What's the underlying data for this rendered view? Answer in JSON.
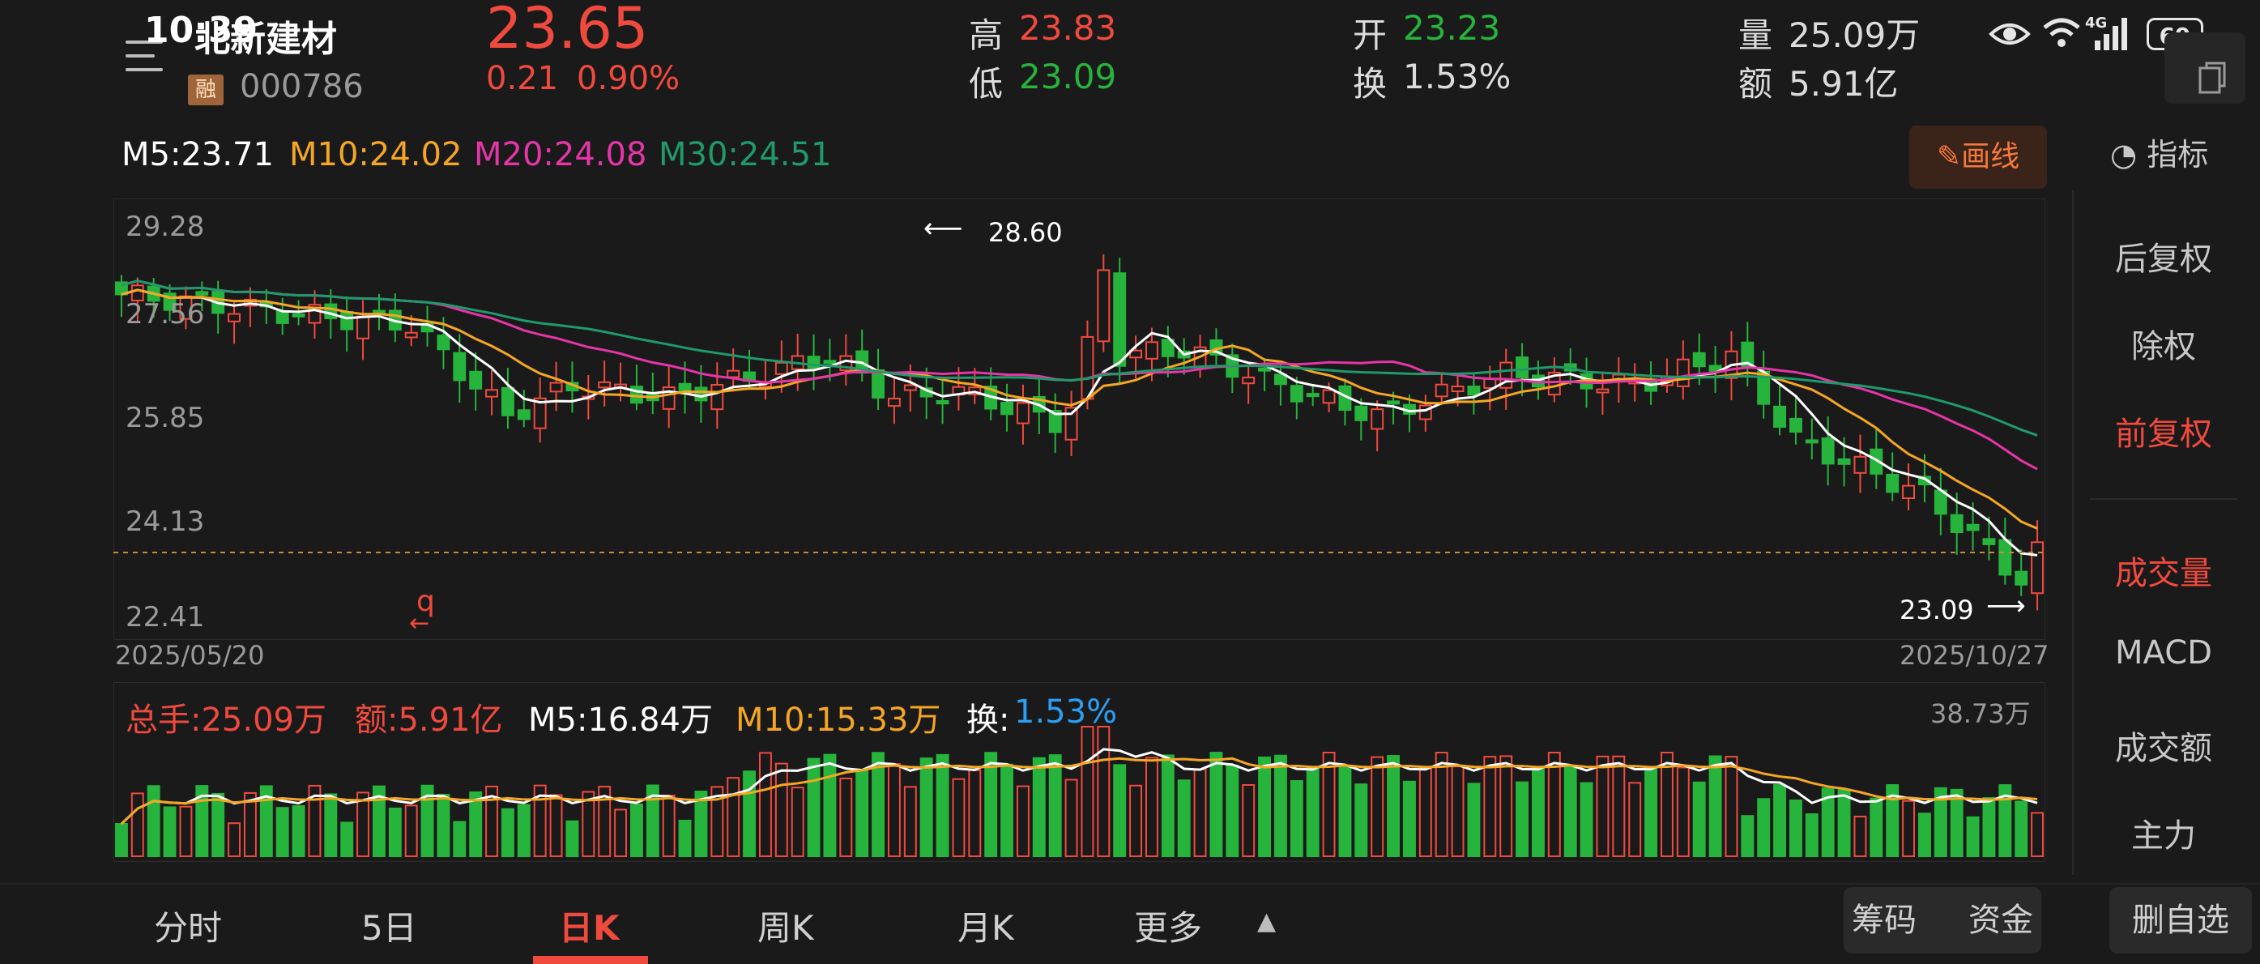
{
  "status_bar": {
    "time": "10:39",
    "network": "4G",
    "battery": "69"
  },
  "stock": {
    "name": "北新建材",
    "code": "000786",
    "margin_badge": "融",
    "price": "23.65",
    "change": "0.21",
    "change_pct": "0.90%",
    "high_label": "高",
    "high": "23.83",
    "low_label": "低",
    "low": "23.09",
    "open_label": "开",
    "open": "23.23",
    "turnover_label": "换",
    "turnover": "1.53%",
    "volume_label": "量",
    "volume": "25.09万",
    "amount_label": "额",
    "amount": "5.91亿"
  },
  "ma_legend": {
    "m5": "M5:23.71",
    "m10": "M10:24.02",
    "m20": "M20:24.08",
    "m30": "M30:24.51"
  },
  "colors": {
    "up": "#f04a3e",
    "down": "#26b43c",
    "m5": "#ffffff",
    "m10": "#f5a623",
    "m20": "#e535a8",
    "m30": "#1f9a6b",
    "turnover_value": "#2b9ff5",
    "draw_accent": "#f5793a"
  },
  "toolbar": {
    "draw_label": "画线",
    "indicator_label": "指标"
  },
  "chart": {
    "max_annotation": "28.60",
    "min_annotation": "23.09",
    "axis_labels": [
      "29.28",
      "27.56",
      "25.85",
      "24.13",
      "22.41"
    ],
    "start_date": "2025/05/20",
    "end_date": "2025/10/27",
    "q_marker": "q"
  },
  "chart_data": {
    "type": "candlestick",
    "x_range": [
      "2025/05/20",
      "2025/10/27"
    ],
    "y_axis_ticks": [
      29.28,
      27.56,
      25.85,
      24.13,
      22.41
    ],
    "ylim": [
      22.41,
      29.28
    ],
    "period_high": 28.6,
    "period_low": 23.09,
    "last_close": 23.65,
    "moving_averages": {
      "M5": 23.71,
      "M10": 24.02,
      "M20": 24.08,
      "M30": 24.51
    }
  },
  "volume_panel": {
    "total_label": "总手:25.09万",
    "amount_label": "额:5.91亿",
    "m5": "M5:16.84万",
    "m10": "M10:15.33万",
    "turnover_label": "换:",
    "turnover_value": "1.53%",
    "max_label": "38.73万"
  },
  "side_panel": {
    "items": [
      "后复权",
      "除权",
      "前复权",
      "成交量",
      "MACD",
      "成交额",
      "主力"
    ]
  },
  "bottom_tabs": [
    "分时",
    "5日",
    "日K",
    "周K",
    "月K",
    "更多"
  ],
  "bottom_buttons": [
    "筹码",
    "资金",
    "删自选"
  ]
}
